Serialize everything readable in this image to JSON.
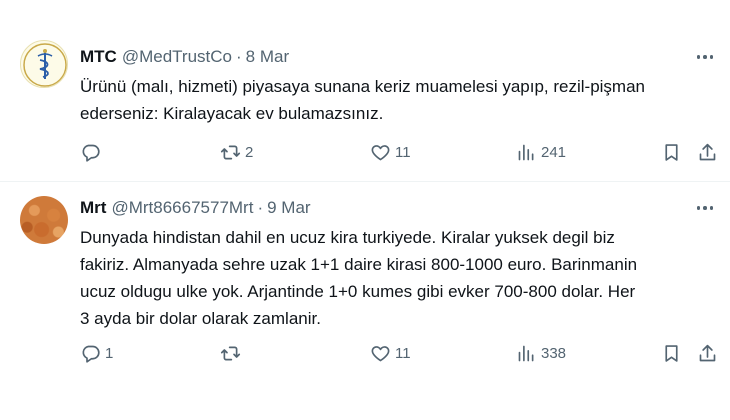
{
  "tweets": [
    {
      "name": "MTC",
      "handle": "@MedTrustCo",
      "separator": "·",
      "date": "8 Mar",
      "text": "Ürünü (malı, hizmeti) piyasaya sunana keriz muamelesi yapıp, rezil-pişman\nederseniz: Kiralayacak ev bulamazsınız.",
      "replies": "",
      "reposts": "2",
      "likes": "11",
      "views": "241"
    },
    {
      "name": "Mrt",
      "handle": "@Mrt86667577Mrt",
      "separator": "·",
      "date": "9 Mar",
      "text": "Dunyada hindistan dahil en ucuz kira turkiyede. Kiralar yuksek degil biz\nfakiriz. Almanyada sehre uzak 1+1 daire kirasi 800-1000 euro. Barinmanin\nucuz oldugu ulke yok. Arjantinde 1+0 kumes gibi evker 700-800 dolar. Her\n3 ayda bir dolar olarak zamlanir.",
      "replies": "1",
      "reposts": "",
      "likes": "11",
      "views": "338"
    }
  ],
  "icons": {
    "reply": "reply-icon",
    "repost": "repost-icon",
    "like": "heart-icon",
    "views": "views-icon",
    "bookmark": "bookmark-icon",
    "share": "share-icon",
    "more": "more-icon"
  },
  "colors": {
    "text": "#0f1419",
    "secondary": "#536471",
    "divider": "#eff3f4"
  }
}
